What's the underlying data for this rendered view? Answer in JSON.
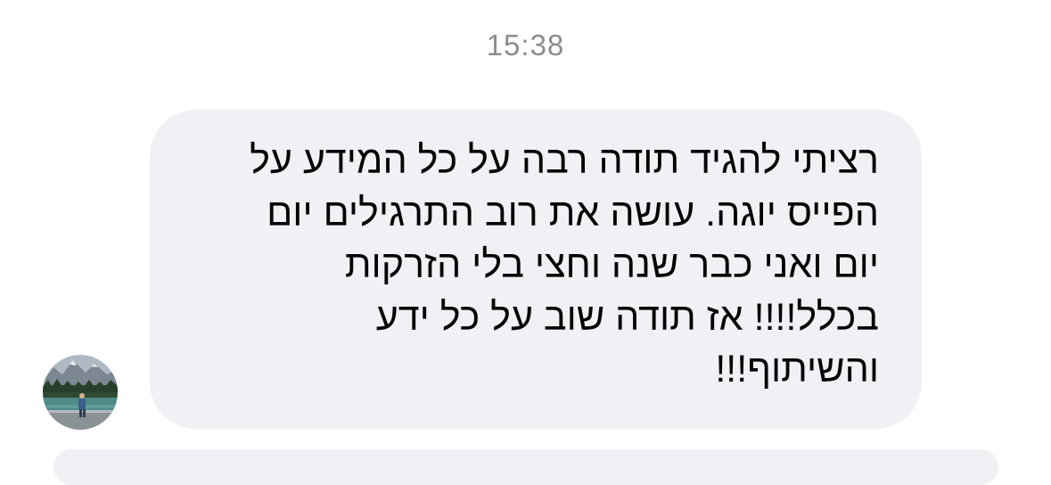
{
  "conversation": {
    "timestamp": "15:38",
    "message": {
      "lines": [
        "רציתי להגיד תודה רבה על כל המידע על",
        "הפייס יוגה. עושה את רוב התרגילים יום",
        "יום ואני כבר שנה וחצי בלי הזרקות",
        "בכלל!!!! אז תודה שוב על כל ידע",
        "והשיתוף!!!"
      ]
    },
    "sender_avatar": "user-avatar-photo",
    "colors": {
      "bubble": "#f0f1f5",
      "text": "#050505",
      "timestamp": "#8a8d91",
      "background": "#ffffff"
    }
  }
}
